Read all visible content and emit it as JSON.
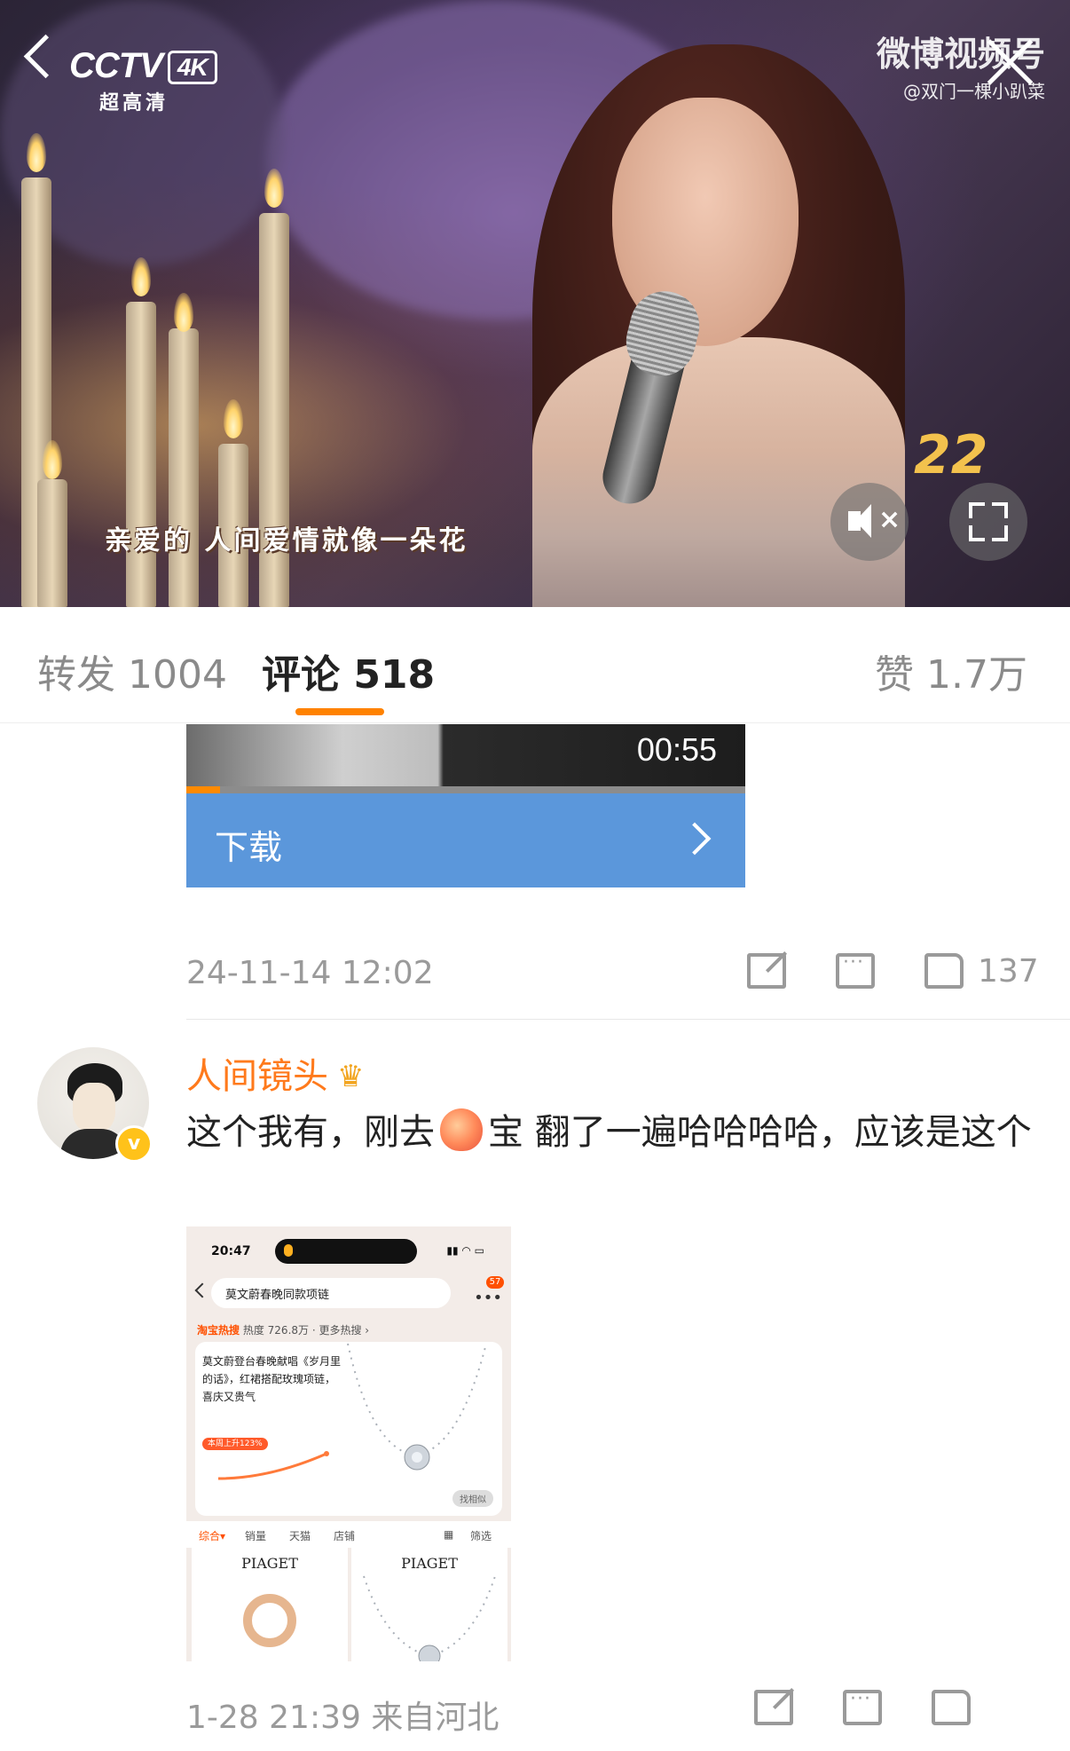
{
  "video": {
    "channel_logo": "CCTV",
    "quality_badge": "4K",
    "quality_text": "超高清",
    "watermark_title": "微博视频号",
    "watermark_user": "@双门一棵小趴菜",
    "subtitle": "亲爱的 人间爱情就像一朵花",
    "show_logo": "22",
    "muted": true
  },
  "tabs": {
    "repost": "转发 1004",
    "comment": "评论 518",
    "like": "赞 1.7万",
    "active": "comment",
    "accent": "#ff8200"
  },
  "embed": {
    "duration": "00:55",
    "progress": 0.06,
    "download_label": "下载",
    "button_color": "#5b97db"
  },
  "post_meta": {
    "time": "24-11-14 12:02",
    "like_count": "137"
  },
  "comment": {
    "username": "人间镜头",
    "username_color": "#ff7a1c",
    "verified": true,
    "text_before": "这个我有，刚去",
    "emoji": "peach-emoji",
    "text_after": "宝 翻了一遍哈哈哈哈，应该是这个",
    "time_location": "1-28 21:39 来自河北",
    "image": {
      "status_time": "20:47",
      "search_query": "莫文蔚春晚同款项链",
      "badge": "57",
      "hot_brand": "淘宝热搜",
      "hot_info": "热度 726.8万 · 更多热搜 ›",
      "card_text": "莫文蔚登台春晚献唱《岁月里的话》，红裙搭配玫瑰项链，喜庆又贵气",
      "card_tag": "本周上升123%",
      "find_similar": "找相似",
      "filters": [
        "综合▾",
        "销量",
        "天猫",
        "店铺",
        "筛选"
      ],
      "products": [
        {
          "brand": "PIAGET",
          "item": "ring"
        },
        {
          "brand": "PIAGET",
          "item": "necklace"
        }
      ]
    }
  }
}
